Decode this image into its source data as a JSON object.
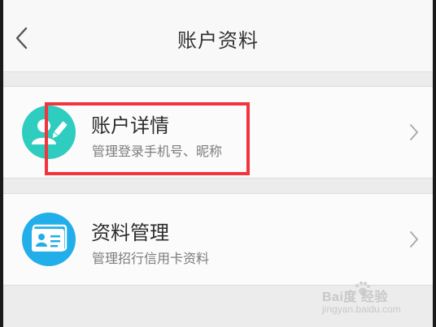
{
  "header": {
    "title": "账户资料",
    "back_icon": "chevron-left-icon"
  },
  "items": [
    {
      "title": "账户详情",
      "subtitle": "管理登录手机号、昵称",
      "icon": "user-edit-icon",
      "icon_color": "#2ecdc0",
      "highlighted": true
    },
    {
      "title": "资料管理",
      "subtitle": "管理招行信用卡资料",
      "icon": "id-card-icon",
      "icon_color": "#21aee9",
      "highlighted": false
    }
  ],
  "colors": {
    "highlight": "#f2353d",
    "background": "#ececec",
    "card": "#fbfbfb"
  },
  "watermark": {
    "brand": "Bai度 经验",
    "url": "jingyan.baidu.com"
  }
}
